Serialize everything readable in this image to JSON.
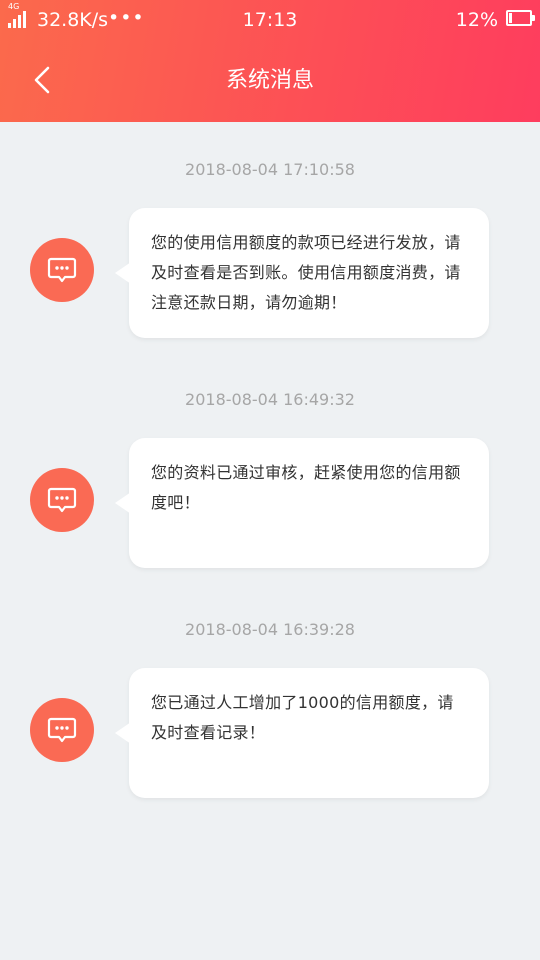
{
  "status_bar": {
    "network": "4G",
    "speed": "32.8K/s",
    "more": "•••",
    "time": "17:13",
    "battery": "12%"
  },
  "header": {
    "title": "系统消息",
    "back_icon": "chevron-left-icon"
  },
  "colors": {
    "header_gradient_start": "#fb6a4c",
    "header_gradient_end": "#fe3d5e",
    "avatar": "#fa6a54",
    "background": "#eef1f3"
  },
  "messages": [
    {
      "time": "2018-08-04 17:10:58",
      "text": "您的使用信用额度的款项已经进行发放，请及时查看是否到账。使用信用额度消费，请注意还款日期，请勿逾期！",
      "icon": "message-icon"
    },
    {
      "time": "2018-08-04 16:49:32",
      "text": "您的资料已通过审核，赶紧使用您的信用额度吧！",
      "icon": "message-icon"
    },
    {
      "time": "2018-08-04 16:39:28",
      "text": "您已通过人工增加了1000的信用额度，请及时查看记录！",
      "icon": "message-icon"
    }
  ]
}
